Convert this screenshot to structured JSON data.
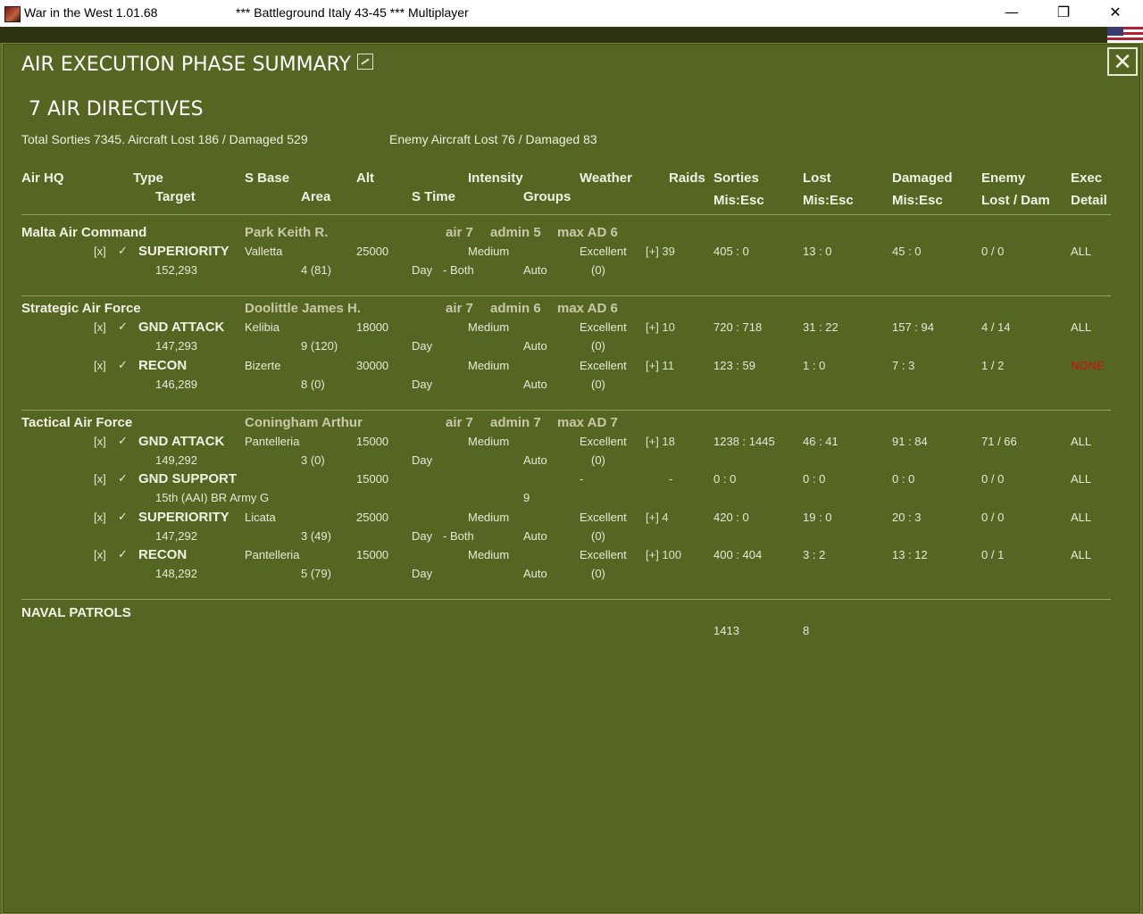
{
  "window": {
    "app_title": "War in the West  1.01.68",
    "subtitle": "***   Battleground Italy 43-45   ***   Multiplayer",
    "min": "—",
    "max": "❐",
    "close": "✕"
  },
  "dialog": {
    "title": "AIR EXECUTION PHASE SUMMARY",
    "close": "✕",
    "directives_count": "7 AIR DIRECTIVES",
    "summary_left": "Total Sorties 7345. Aircraft Lost 186 / Damaged 529",
    "summary_right": "Enemy Aircraft Lost 76 / Damaged 83"
  },
  "headers": {
    "air_hq": "Air HQ",
    "type": "Type",
    "target": "Target",
    "s_base": "S Base",
    "area": "Area",
    "alt": "Alt",
    "intensity": "Intensity",
    "s_time": "S Time",
    "groups": "Groups",
    "weather": "Weather",
    "raids": "Raids",
    "sorties": "Sorties",
    "sorties_sub": "Mis:Esc",
    "lost": "Lost",
    "lost_sub": "Mis:Esc",
    "damaged": "Damaged",
    "damaged_sub": "Mis:Esc",
    "enemy": "Enemy",
    "enemy_sub": "Lost / Dam",
    "exec": "Exec",
    "exec_sub": "Detail"
  },
  "hqs": [
    {
      "name": "Malta Air Command",
      "commander": "Park Keith R.",
      "air": "air 7",
      "admin": "admin 5",
      "max_ad": "max AD 6",
      "directives": [
        {
          "x": "[x]",
          "check": "✓",
          "type": "SUPERIORITY",
          "target": "152,293",
          "base": "Valletta",
          "area": "4 (81)",
          "alt": "25000",
          "time": "Day",
          "time2": "- Both",
          "intensity": "Medium",
          "groups": "Auto",
          "weather": "Excellent",
          "wx2": "(0)",
          "raids": "[+] 39",
          "sorties": "405 : 0",
          "lost": "13 : 0",
          "damaged": "45 : 0",
          "enemy": "0 / 0",
          "exec": "ALL"
        }
      ]
    },
    {
      "name": "Strategic Air Force",
      "commander": "Doolittle James H.",
      "air": "air 7",
      "admin": "admin 6",
      "max_ad": "max AD 6",
      "directives": [
        {
          "x": "[x]",
          "check": "✓",
          "type": "GND ATTACK",
          "target": "147,293",
          "base": "Kelibia",
          "area": "9 (120)",
          "alt": "18000",
          "time": "Day",
          "time2": "",
          "intensity": "Medium",
          "groups": "Auto",
          "weather": "Excellent",
          "wx2": "(0)",
          "raids": "[+] 10",
          "sorties": "720 : 718",
          "lost": "31 : 22",
          "damaged": "157 : 94",
          "enemy": "4 / 14",
          "exec": "ALL"
        },
        {
          "x": "[x]",
          "check": "✓",
          "type": "RECON",
          "target": "146,289",
          "base": "Bizerte",
          "area": "8 (0)",
          "alt": "30000",
          "time": "Day",
          "time2": "",
          "intensity": "Medium",
          "groups": "Auto",
          "weather": "Excellent",
          "wx2": "(0)",
          "raids": "[+] 11",
          "sorties": "123 : 59",
          "lost": "1 : 0",
          "damaged": "7 : 3",
          "enemy": "1 / 2",
          "exec": "NONE"
        }
      ]
    },
    {
      "name": "Tactical Air Force",
      "commander": "Coningham Arthur",
      "air": "air 7",
      "admin": "admin 7",
      "max_ad": "max AD 7",
      "directives": [
        {
          "x": "[x]",
          "check": "✓",
          "type": "GND ATTACK",
          "target": "149,292",
          "base": "Pantelleria",
          "area": "3 (0)",
          "alt": "15000",
          "time": "Day",
          "time2": "",
          "intensity": "Medium",
          "groups": "Auto",
          "weather": "Excellent",
          "wx2": "(0)",
          "raids": "[+] 18",
          "sorties": "1238 : 1445",
          "lost": "46 : 41",
          "damaged": "91 : 84",
          "enemy": "71 / 66",
          "exec": "ALL"
        },
        {
          "x": "[x]",
          "check": "✓",
          "type": "GND SUPPORT",
          "target": "15th (AAI) BR Army G",
          "base": "",
          "area": "",
          "alt": "15000",
          "time": "",
          "time2": "",
          "intensity": "",
          "groups": "9",
          "weather": "-",
          "wx2": "",
          "raids": "-",
          "sorties": "0 : 0",
          "lost": "0 : 0",
          "damaged": "0 : 0",
          "enemy": "0 / 0",
          "exec": "ALL"
        },
        {
          "x": "[x]",
          "check": "✓",
          "type": "SUPERIORITY",
          "target": "147,292",
          "base": "Licata",
          "area": "3 (49)",
          "alt": "25000",
          "time": "Day",
          "time2": "- Both",
          "intensity": "Medium",
          "groups": "Auto",
          "weather": "Excellent",
          "wx2": "(0)",
          "raids": "[+] 4",
          "sorties": "420 : 0",
          "lost": "19 : 0",
          "damaged": "20 : 3",
          "enemy": "0 / 0",
          "exec": "ALL"
        },
        {
          "x": "[x]",
          "check": "✓",
          "type": "RECON",
          "target": "148,292",
          "base": "Pantelleria",
          "area": "5 (79)",
          "alt": "15000",
          "time": "Day",
          "time2": "",
          "intensity": "Medium",
          "groups": "Auto",
          "weather": "Excellent",
          "wx2": "(0)",
          "raids": "[+] 100",
          "sorties": "400 : 404",
          "lost": "3 : 2",
          "damaged": "13 : 12",
          "enemy": "0 / 1",
          "exec": "ALL"
        }
      ]
    }
  ],
  "naval": {
    "label": "NAVAL PATROLS",
    "sorties": "1413",
    "lost": "8"
  }
}
